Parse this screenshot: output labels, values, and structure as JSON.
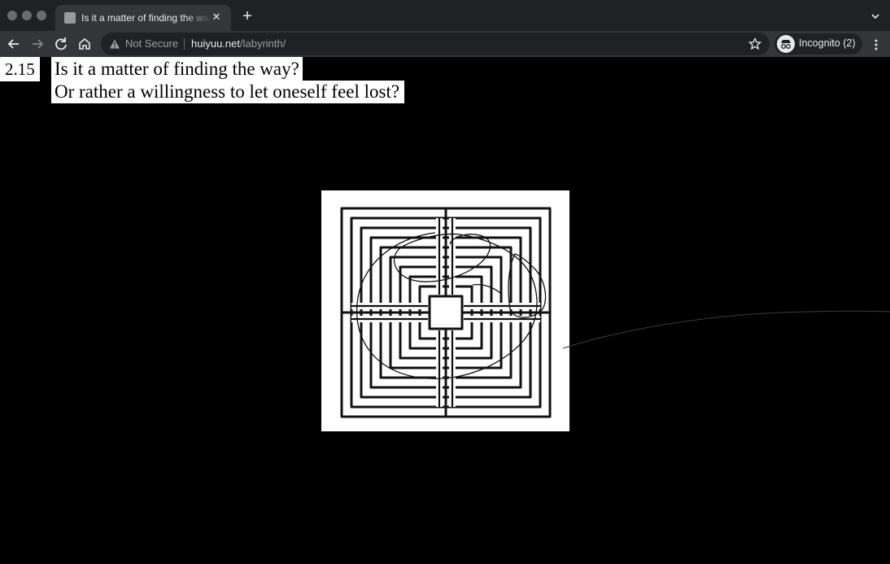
{
  "browser": {
    "tab": {
      "title": "Is it a matter of finding the way? Or rather a willingness to let oneself feel lost?",
      "close_glyph": "✕"
    },
    "new_tab_glyph": "+",
    "omnibox": {
      "security_label": "Not Secure",
      "url_host": "huiyuu.net",
      "url_path": "/labyrinth/"
    },
    "profile": {
      "label": "Incognito (2)"
    },
    "icons": {
      "back": "arrow-left-icon",
      "forward": "arrow-right-icon",
      "reload": "reload-icon",
      "home": "home-icon",
      "warning": "warning-icon",
      "bookmark": "star-icon",
      "incognito": "incognito-icon",
      "menu": "kebab-menu-icon",
      "tab_search": "chevron-down-icon"
    },
    "colors": {
      "frame": "#202124",
      "toolbar": "#35363a",
      "text": "#e8eaed",
      "muted": "#9aa0a6"
    }
  },
  "page": {
    "background": "#000000",
    "number": "2.15",
    "question_line_1": "Is it a matter of finding the way?",
    "question_line_2": "Or rather a willingness to let oneself feel lost?",
    "image_subject": "labyrinth drawing with hand-drawn line"
  }
}
